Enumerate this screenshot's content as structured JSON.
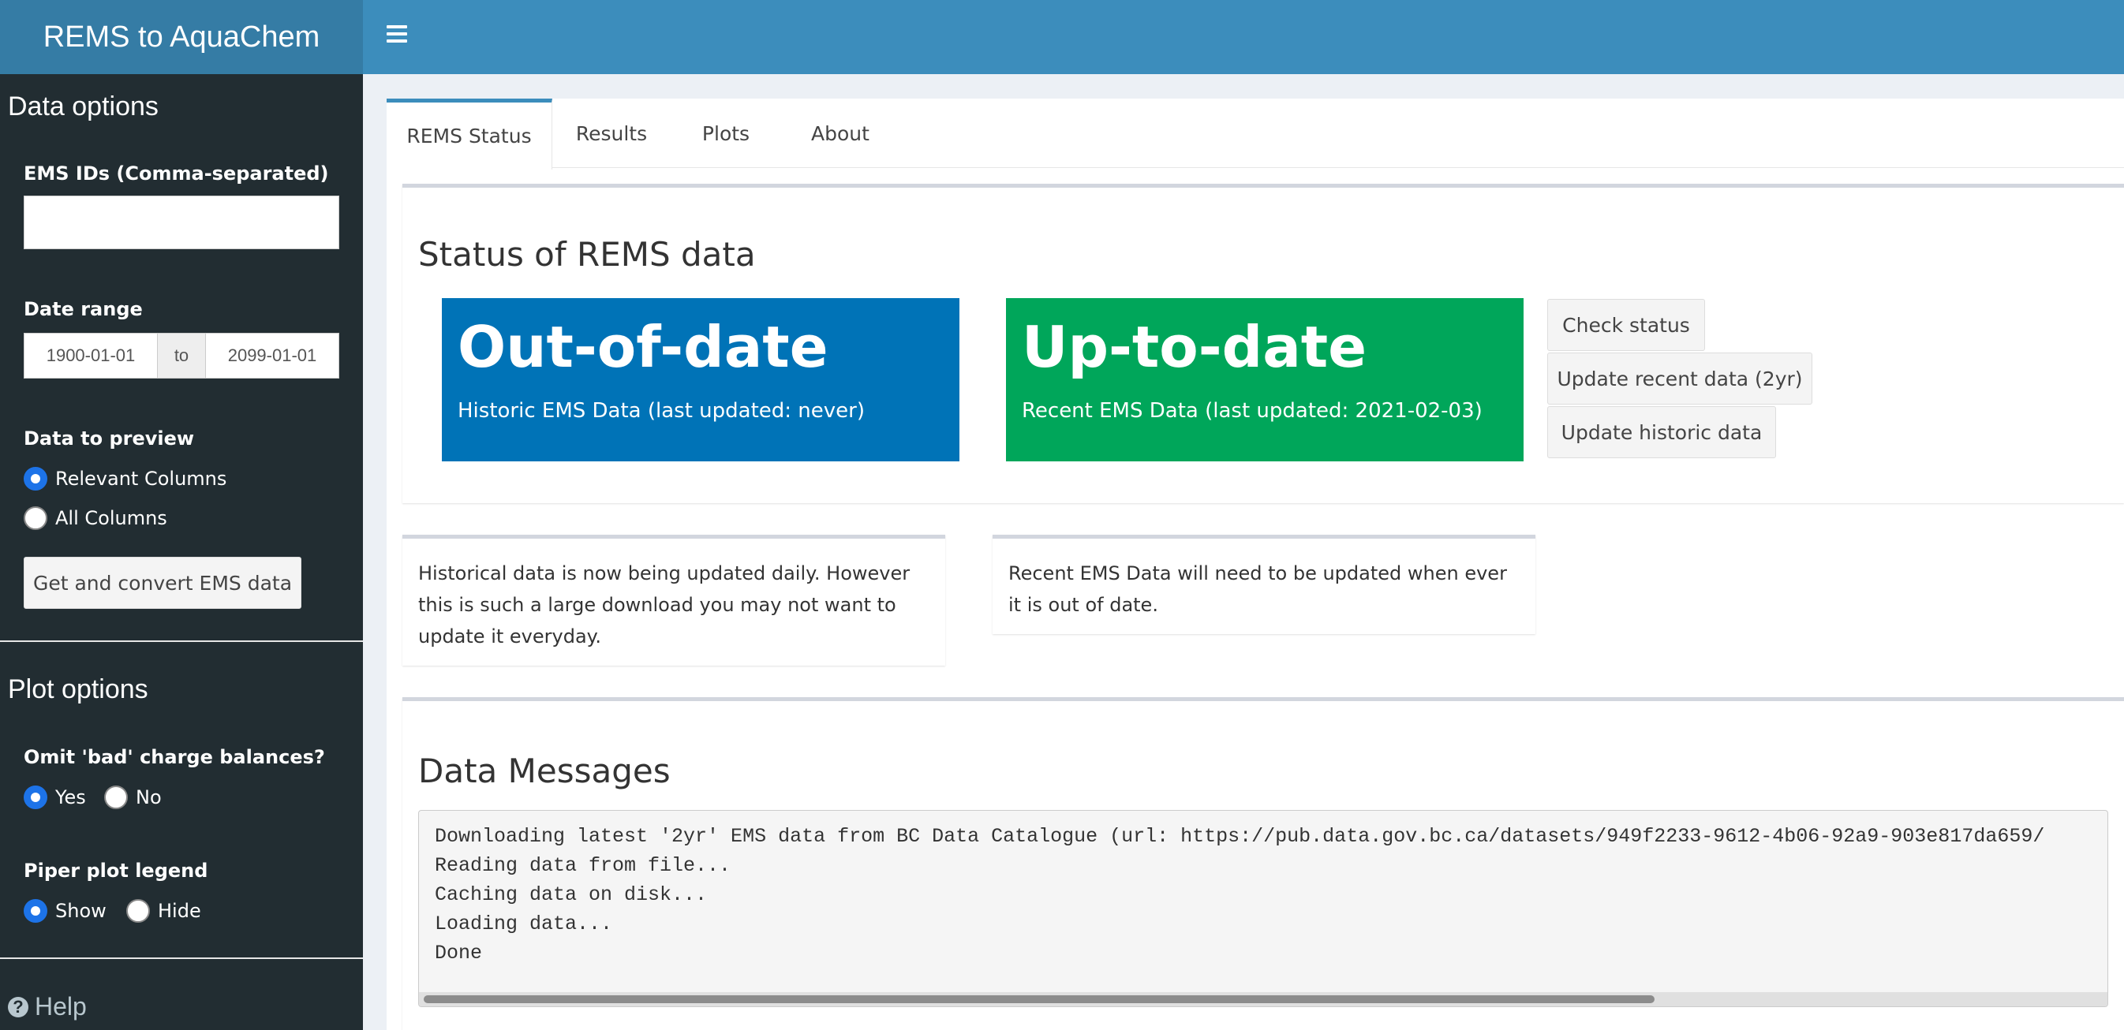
{
  "app": {
    "title": "REMS to AquaChem"
  },
  "sidebar": {
    "data_options_title": "Data options",
    "ems_ids_label": "EMS IDs (Comma-separated)",
    "ems_ids_value": "",
    "date_range_label": "Date range",
    "date_start": "1900-01-01",
    "date_sep": "to",
    "date_end": "2099-01-01",
    "preview_label": "Data to preview",
    "preview_options": [
      "Relevant Columns",
      "All Columns"
    ],
    "preview_selected": "Relevant Columns",
    "convert_button": "Get and convert EMS data",
    "plot_options_title": "Plot options",
    "omit_label": "Omit 'bad' charge balances?",
    "omit_options": [
      "Yes",
      "No"
    ],
    "omit_selected": "Yes",
    "legend_label": "Piper plot legend",
    "legend_options": [
      "Show",
      "Hide"
    ],
    "legend_selected": "Show",
    "help_label": "Help",
    "help_icon": "question-icon"
  },
  "header": {
    "menu_icon": "hamburger-icon"
  },
  "tabs": [
    {
      "label": "REMS Status",
      "active": true
    },
    {
      "label": "Results",
      "active": false
    },
    {
      "label": "Plots",
      "active": false
    },
    {
      "label": "About",
      "active": false
    }
  ],
  "status": {
    "title": "Status of REMS data",
    "historic": {
      "value": "Out-of-date",
      "subtitle": "Historic EMS Data (last updated: never)",
      "color": "#0073b7"
    },
    "recent": {
      "value": "Up-to-date",
      "subtitle": "Recent EMS Data (last updated: 2021-02-03)",
      "color": "#00a65a"
    },
    "buttons": {
      "check": "Check status",
      "update_recent": "Update recent data (2yr)",
      "update_historic": "Update historic data"
    }
  },
  "notes": {
    "historic": "Historical data is now being updated daily. However this is such a large download you may not want to update it everyday.",
    "recent": "Recent EMS Data will need to be updated when ever it is out of date."
  },
  "messages": {
    "title": "Data Messages",
    "lines": [
      "Downloading latest '2yr' EMS data from BC Data Catalogue (url: https://pub.data.gov.bc.ca/datasets/949f2233-9612-4b06-92a9-903e817da659/",
      "Reading data from file...",
      "Caching data on disk...",
      "Loading data...",
      "Done"
    ]
  }
}
